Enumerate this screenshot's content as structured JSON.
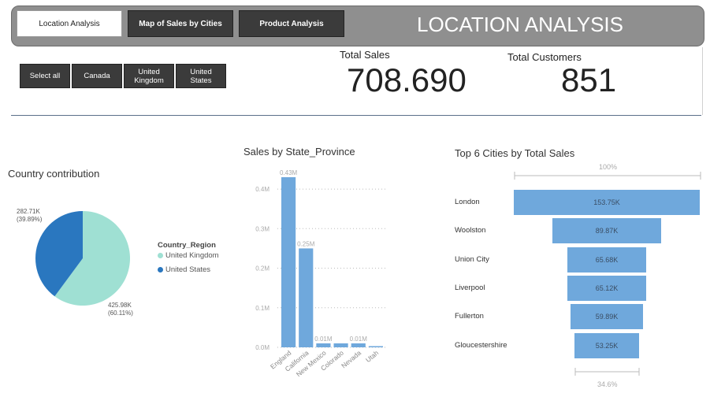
{
  "header": {
    "tabs": [
      {
        "label": "Location Analysis",
        "active": true
      },
      {
        "label": "Map of Sales by Cities",
        "active": false
      },
      {
        "label": "Product Analysis",
        "active": false
      }
    ],
    "title": "LOCATION ANALYSIS"
  },
  "filters": [
    {
      "label": "Select all"
    },
    {
      "label": "Canada"
    },
    {
      "label": "United Kingdom"
    },
    {
      "label": "United States"
    }
  ],
  "kpis": {
    "total_sales": {
      "label": "Total Sales",
      "value": "708.690"
    },
    "total_customers": {
      "label": "Total Customers",
      "value": "851"
    }
  },
  "colors": {
    "header_bg": "#8f8f8f",
    "button_dark": "#3b3b3b",
    "uk": "#9fe0d3",
    "us": "#2a77bf",
    "bar": "#6fa8dc"
  },
  "chart_data": [
    {
      "type": "pie",
      "title": "Country contribution",
      "legend_title": "Country_Region",
      "slices": [
        {
          "name": "United Kingdom",
          "value": 425.98,
          "label": "425.98K",
          "pct_label": "(60.11%)",
          "color": "#9fe0d3"
        },
        {
          "name": "United States",
          "value": 282.71,
          "label": "282.71K",
          "pct_label": "(39.89%)",
          "color": "#2a77bf"
        }
      ]
    },
    {
      "type": "bar",
      "title": "Sales by State_Province",
      "categories": [
        "England",
        "California",
        "New Mexico",
        "Colorado",
        "Nevada",
        "Utah"
      ],
      "values": [
        0.43,
        0.25,
        0.01,
        0.01,
        0.01,
        0.003
      ],
      "data_labels": [
        "0.43M",
        "0.25M",
        "0.01M",
        "",
        "0.01M",
        ""
      ],
      "yticks": [
        "0.0M",
        "0.1M",
        "0.2M",
        "0.3M",
        "0.4M"
      ],
      "ylim": [
        0,
        0.43
      ],
      "xlabel": "",
      "ylabel": ""
    },
    {
      "type": "bar",
      "title": "Top 6 Cities by Total Sales",
      "categories": [
        "London",
        "Woolston",
        "Union City",
        "Liverpool",
        "Fullerton",
        "Gloucestershire"
      ],
      "values": [
        153.75,
        89.87,
        65.68,
        65.12,
        59.89,
        53.25
      ],
      "data_labels": [
        "153.75K",
        "89.87K",
        "65.68K",
        "65.12K",
        "59.89K",
        "53.25K"
      ],
      "top_pct": "100%",
      "bottom_pct": "34.6%"
    }
  ]
}
